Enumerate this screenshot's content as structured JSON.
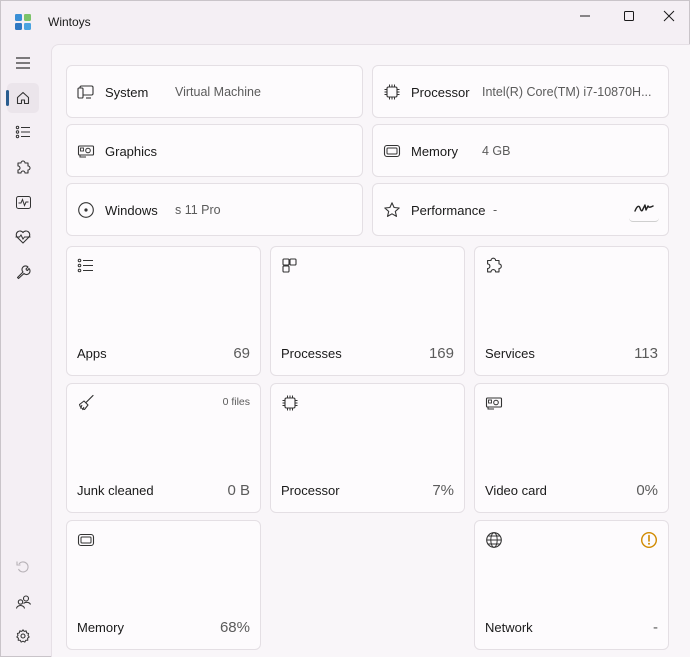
{
  "window": {
    "title": "Wintoys",
    "controls": {
      "minimize": "minimize-icon",
      "maximize": "maximize-icon",
      "close": "close-icon"
    }
  },
  "sidebar": {
    "items": [
      {
        "name": "menu",
        "icon": "hamburger-icon"
      },
      {
        "name": "home",
        "icon": "home-icon",
        "active": true
      },
      {
        "name": "apps",
        "icon": "list-icon"
      },
      {
        "name": "services",
        "icon": "puzzle-icon"
      },
      {
        "name": "performance",
        "icon": "activity-icon"
      },
      {
        "name": "health",
        "icon": "heartbeat-icon"
      },
      {
        "name": "tools",
        "icon": "wrench-icon"
      }
    ],
    "bottom": [
      {
        "name": "undo",
        "icon": "undo-icon"
      },
      {
        "name": "account",
        "icon": "people-icon"
      },
      {
        "name": "settings",
        "icon": "gear-icon"
      }
    ]
  },
  "info": {
    "system": {
      "label": "System",
      "value": "Virtual Machine"
    },
    "processor": {
      "label": "Processor",
      "value": "Intel(R) Core(TM) i7-10870H..."
    },
    "graphics": {
      "label": "Graphics",
      "value": ""
    },
    "memory": {
      "label": "Memory",
      "value": "4 GB"
    },
    "windows": {
      "label": "Windows",
      "value": "s 11 Pro"
    },
    "performance": {
      "label": "Performance",
      "value": "-"
    }
  },
  "tiles": {
    "apps": {
      "label": "Apps",
      "value": "69"
    },
    "processes": {
      "label": "Processes",
      "value": "169"
    },
    "services": {
      "label": "Services",
      "value": "113"
    },
    "junk": {
      "label": "Junk cleaned",
      "value": "0 B",
      "sub": "0 files"
    },
    "processor": {
      "label": "Processor",
      "value": "7%"
    },
    "videocard": {
      "label": "Video card",
      "value": "0%"
    },
    "memory": {
      "label": "Memory",
      "value": "68%"
    },
    "network": {
      "label": "Network",
      "value": "-"
    }
  },
  "colors": {
    "accent": "#2a5d8f",
    "warning": "#d08a00"
  }
}
